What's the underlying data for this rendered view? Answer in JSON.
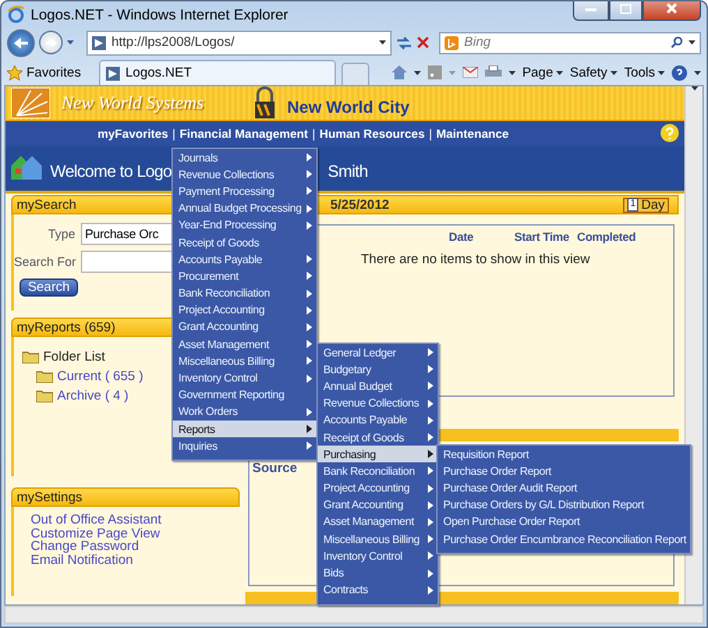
{
  "window": {
    "title": "Logos.NET - Windows Internet Explorer"
  },
  "address_bar": {
    "url": "http://lps2008/Logos/"
  },
  "search_box": {
    "placeholder": "Bing"
  },
  "favorites": {
    "label": "Favorites"
  },
  "tabs": [
    {
      "label": "Logos.NET",
      "selected": true
    }
  ],
  "command_bar": [
    "Page",
    "Safety",
    "Tools"
  ],
  "banner": {
    "brand": "New World Systems",
    "city": "New World City"
  },
  "nav": {
    "separator": "|",
    "items": [
      "myFavorites",
      "Financial Management",
      "Human Resources",
      "Maintenance"
    ]
  },
  "welcome": [
    "Welcome to Logo",
    "Smith"
  ],
  "search_panel": {
    "title": "mySearch",
    "type_label": "Type",
    "type_value": "Purchase Orc",
    "search_for_label": "Search For",
    "button": "Search"
  },
  "reports_panel": {
    "title": "myReports (659)",
    "folders": [
      {
        "label": "Folder List",
        "children": [
          {
            "label": "Current ( 655 )"
          },
          {
            "label": "Archive ( 4 )"
          }
        ]
      }
    ]
  },
  "settings_panel": {
    "title": "mySettings",
    "links": [
      "Out of Office Assistant",
      "Customize Page View",
      "Change Password",
      "Email Notification"
    ]
  },
  "calendar": {
    "date": "5/25/2012",
    "day_icon": "1",
    "day_button": "Day",
    "columns": [
      "Date",
      "Start Time",
      "Completed"
    ],
    "empty_message": "There are no items to show in this view",
    "source_label": "Source"
  },
  "menus": [
    {
      "items": [
        {
          "label": "Journals",
          "submenu": true,
          "selected": false
        },
        {
          "label": "Revenue Collections",
          "submenu": true,
          "selected": false
        },
        {
          "label": "Payment Processing",
          "submenu": true,
          "selected": false
        },
        {
          "label": "Annual Budget Processing",
          "submenu": true,
          "selected": false
        },
        {
          "label": "Year-End Processing",
          "submenu": true,
          "selected": false
        },
        {
          "label": "Receipt of Goods",
          "submenu": false,
          "selected": false
        },
        {
          "label": "Accounts Payable",
          "submenu": true,
          "selected": false
        },
        {
          "label": "Procurement",
          "submenu": true,
          "selected": false
        },
        {
          "label": "Bank Reconciliation",
          "submenu": true,
          "selected": false
        },
        {
          "label": "Project Accounting",
          "submenu": true,
          "selected": false
        },
        {
          "label": "Grant Accounting",
          "submenu": true,
          "selected": false
        },
        {
          "label": "Asset Management",
          "submenu": true,
          "selected": false
        },
        {
          "label": "Miscellaneous Billing",
          "submenu": true,
          "selected": false
        },
        {
          "label": "Inventory Control",
          "submenu": true,
          "selected": false
        },
        {
          "label": "Government Reporting",
          "submenu": false,
          "selected": false
        },
        {
          "label": "Work Orders",
          "submenu": true,
          "selected": false
        },
        {
          "label": "Reports",
          "submenu": true,
          "selected": true
        },
        {
          "label": "Inquiries",
          "submenu": true,
          "selected": false
        }
      ]
    },
    {
      "items": [
        {
          "label": "General Ledger",
          "submenu": true,
          "selected": false
        },
        {
          "label": "Budgetary",
          "submenu": true,
          "selected": false
        },
        {
          "label": "Annual Budget",
          "submenu": true,
          "selected": false
        },
        {
          "label": "Revenue Collections",
          "submenu": true,
          "selected": false
        },
        {
          "label": "Accounts Payable",
          "submenu": true,
          "selected": false
        },
        {
          "label": "Receipt of Goods",
          "submenu": true,
          "selected": false
        },
        {
          "label": "Purchasing",
          "submenu": true,
          "selected": true
        },
        {
          "label": "Bank Reconciliation",
          "submenu": true,
          "selected": false
        },
        {
          "label": "Project Accounting",
          "submenu": true,
          "selected": false
        },
        {
          "label": "Grant Accounting",
          "submenu": true,
          "selected": false
        },
        {
          "label": "Asset Management",
          "submenu": true,
          "selected": false
        },
        {
          "label": "Miscellaneous Billing",
          "submenu": true,
          "selected": false
        },
        {
          "label": "Inventory Control",
          "submenu": true,
          "selected": false
        },
        {
          "label": "Bids",
          "submenu": true,
          "selected": false
        },
        {
          "label": "Contracts",
          "submenu": true,
          "selected": false
        }
      ]
    },
    {
      "items": [
        {
          "label": "Requisition Report",
          "submenu": false,
          "selected": false
        },
        {
          "label": "Purchase Order Report",
          "submenu": false,
          "selected": false
        },
        {
          "label": "Purchase Order Audit Report",
          "submenu": false,
          "selected": false
        },
        {
          "label": "Purchase Orders by G/L Distribution Report",
          "submenu": false,
          "selected": false
        },
        {
          "label": "Open Purchase Order Report",
          "submenu": false,
          "selected": false
        },
        {
          "label": "Purchase Order Encumbrance Reconciliation Report",
          "submenu": false,
          "selected": false
        }
      ]
    }
  ]
}
